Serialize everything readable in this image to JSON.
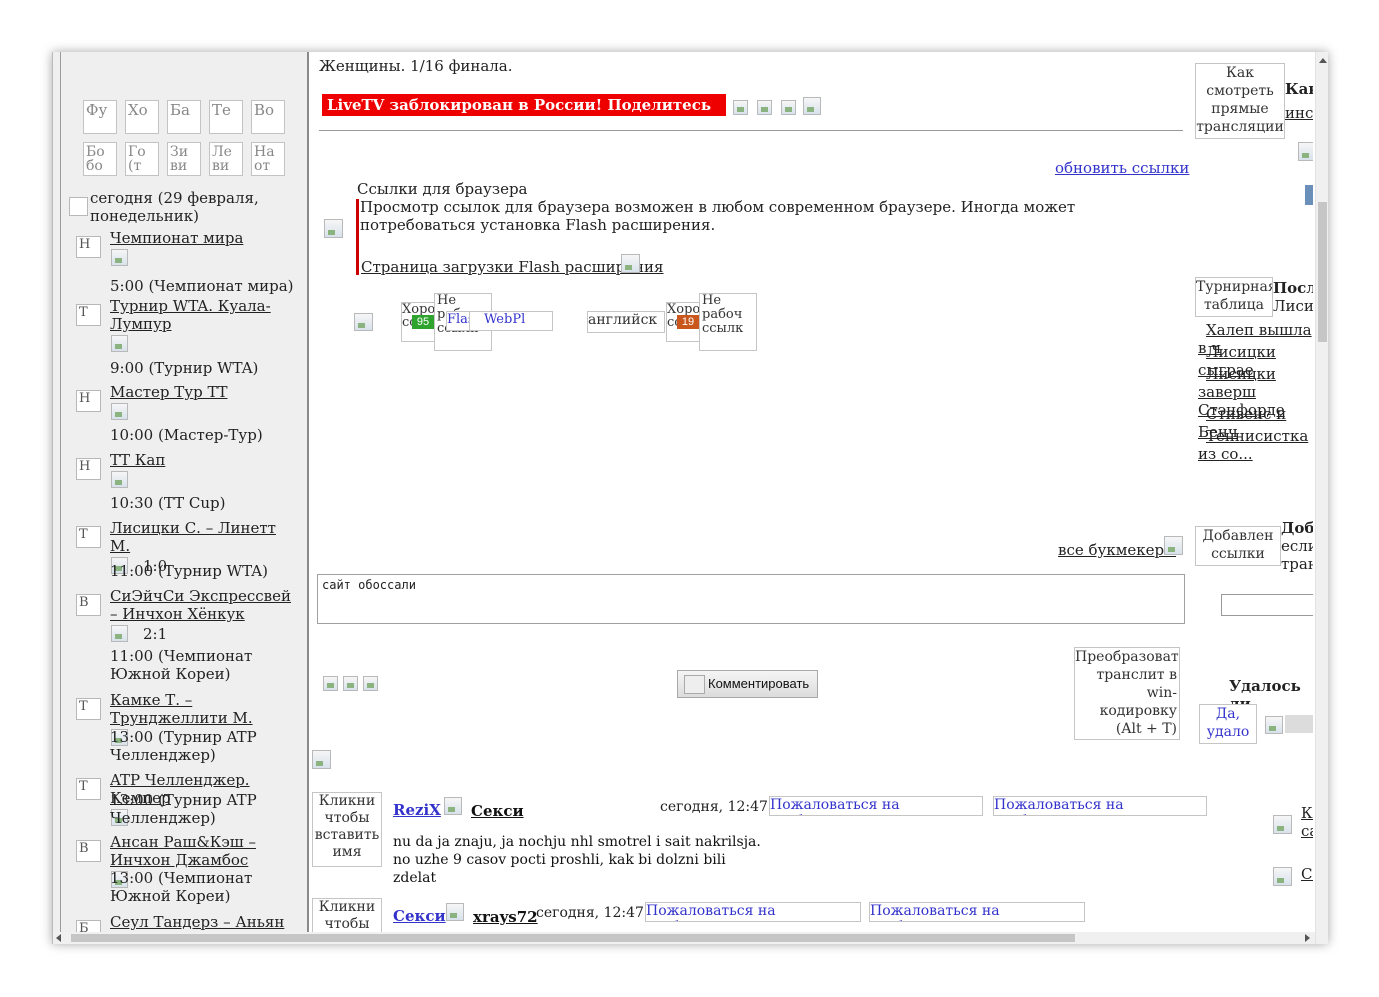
{
  "header": {
    "title": "Женщины. 1/16 финала.",
    "banner": "LiveTV заблокирован в России! Поделитесь ссылкой >"
  },
  "sport_icons": {
    "row1": [
      "Фу",
      "Хо",
      "Ба",
      "Те",
      "Во"
    ],
    "row2": [
      "Бо бо",
      "Го (т",
      "Зи ви",
      "Ле ви",
      "На от"
    ]
  },
  "date_label": "сегодня (29 февраля, понедельник)",
  "events": [
    {
      "title": "Чемпионат мира",
      "icon": "Н",
      "score": "",
      "time": "5:00 (Чемпионат мира)",
      "visited": false
    },
    {
      "title": "Турнир WTA. Куала-Лумпур",
      "icon": "Т",
      "score": "",
      "time": "9:00 (Турнир WTA)",
      "visited": false
    },
    {
      "title": "Мастер Тур ТТ",
      "icon": "Н",
      "score": "",
      "time": "10:00 (Мастер-Тур)",
      "visited": false
    },
    {
      "title": "ТТ Кап",
      "icon": "Н",
      "score": "",
      "time": "10:30 (TT Cup)",
      "visited": false
    },
    {
      "title": "Лисицки С. – Линетт М.",
      "icon": "Т",
      "score": "1:0",
      "time": "11:00 (Турнир WTA)",
      "visited": true
    },
    {
      "title": "СиЭйчСи Экспрессвей – Инчхон Хёнкук",
      "icon": "В",
      "score": "2:1",
      "time": "11:00 (Чемпионат Южной Кореи)",
      "visited": true
    },
    {
      "title": "Камке Т. – Трунджеллити М.",
      "icon": "Т",
      "score": "",
      "time": "13:00 (Турнир ATP Челленджер)",
      "visited": false
    },
    {
      "title": "ATP Челленджер. Кемпер",
      "icon": "Т",
      "score": "",
      "time": "13:00 (Турнир ATP Челленджер)",
      "visited": false
    },
    {
      "title": "Ансан Раш&Кэш – Инчхон Джамбос",
      "icon": "В",
      "score": "",
      "time": "13:00 (Чемпионат Южной Кореи)",
      "visited": false
    },
    {
      "title": "Сеул Тандерз – Аньян",
      "icon": "Б",
      "score": "",
      "time": "",
      "visited": false
    }
  ],
  "links_section": {
    "refresh": "обновить ссылки",
    "heading": "Ссылки для браузера",
    "description": "Просмотр ссылок для браузера возможен в любом современном браузере. Иногда может потребоваться установка Flash расширения.",
    "flash_link": "Страница загрузки Flash расширения",
    "stream_row": {
      "good": "Хоро ссылка",
      "not_working": "Не рабоч ссылк",
      "bitrate1": "95",
      "bitrate2": "19",
      "player": "FlashPlay",
      "webplayer": "WebPl",
      "language": "английск"
    },
    "all_bookmakers": "все букмекеры"
  },
  "comment_box": {
    "text": "сайт обоссали",
    "submit_label": "Комментировать",
    "translit_image": "Преобразовать транслит в win-кодировку (Alt + T)"
  },
  "comments": [
    {
      "avatar": "Кликни чтобы вставить имя",
      "author": "ReziX",
      "reply_to": "Секси",
      "time": "сегодня, 12:47",
      "report": "Пожаловаться на сообщение",
      "text": "nu da ja znaju, ja nochju nhl smotrel i sait nakrilsja. no uzhe 9 casov pocti proshli, kak bi dolzni bili zdelat"
    },
    {
      "avatar": "Кликни чтобы",
      "author": "Секси",
      "reply_to": "xrays72",
      "time": "сегодня, 12:47",
      "report": "Пожаловаться на сообщение",
      "text": ""
    }
  ],
  "right_column": {
    "how_to_image": "Как смотреть прямые трансляции",
    "how_to_title": "Как",
    "how_to_link": "инст",
    "table_image": "Турнирная таблица",
    "latest_title": "После",
    "latest_sub": "Лисиц",
    "news": [
      "Халеп вышла в ч",
      "Лисицки сыграе",
      "Лисицки заверш Стэнфорде",
      "Стивенс и Бенч",
      "Теннисистка из со..."
    ],
    "added_image": "Добавлен ссылки",
    "added_title": "Доба",
    "added_text1": "если",
    "added_text2": "трансл",
    "poll_title": "Удалось ли",
    "poll_yes": "Да, удало",
    "bottom_link1": "Ко са",
    "bottom_link2": "Со"
  }
}
